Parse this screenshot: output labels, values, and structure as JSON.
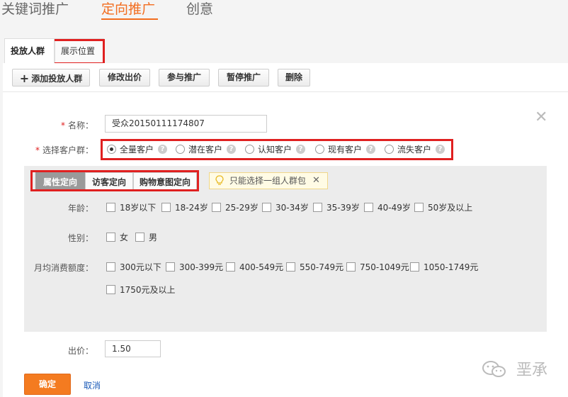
{
  "top_nav": {
    "tabs": [
      "关键词推广",
      "定向推广",
      "创意"
    ],
    "active_index": 1
  },
  "sub_tabs": [
    "投放人群",
    "展示位置"
  ],
  "toolbar": {
    "buttons": [
      "添加投放人群",
      "修改出价",
      "参与推广",
      "暂停推广",
      "删除"
    ]
  },
  "form": {
    "name_label": "名称：",
    "name_value": "受众20150111174807",
    "customer_label": "选择客户群：",
    "customer_options": [
      "全量客户",
      "潜在客户",
      "认知客户",
      "现有客户",
      "流失客户"
    ],
    "customer_selected_index": 0,
    "help_icon": "?",
    "required_mark": "*",
    "close_icon": "✕"
  },
  "targeting": {
    "tabs": [
      "属性定向",
      "访客定向",
      "购物意图定向"
    ],
    "active_tab_index": 0,
    "tip_text": "只能选择一组人群包",
    "tip_close": "✕",
    "age_label": "年龄：",
    "age_options": [
      "18岁以下",
      "18-24岁",
      "25-29岁",
      "30-34岁",
      "35-39岁",
      "40-49岁",
      "50岁及以上"
    ],
    "gender_label": "性别：",
    "gender_options": [
      "女",
      "男"
    ],
    "spend_label": "月均消费额度：",
    "spend_options": [
      "300元以下",
      "300-399元",
      "400-549元",
      "550-749元",
      "750-1049元",
      "1050-1749元",
      "1750元及以上"
    ]
  },
  "bid": {
    "label": "出价：",
    "value": "1.50"
  },
  "actions": {
    "confirm": "确定",
    "cancel": "取消"
  },
  "watermark": {
    "text": "垩承"
  },
  "colors": {
    "accent": "#f26d1f",
    "highlight_box": "#e02020",
    "link": "#1a5ab8"
  }
}
